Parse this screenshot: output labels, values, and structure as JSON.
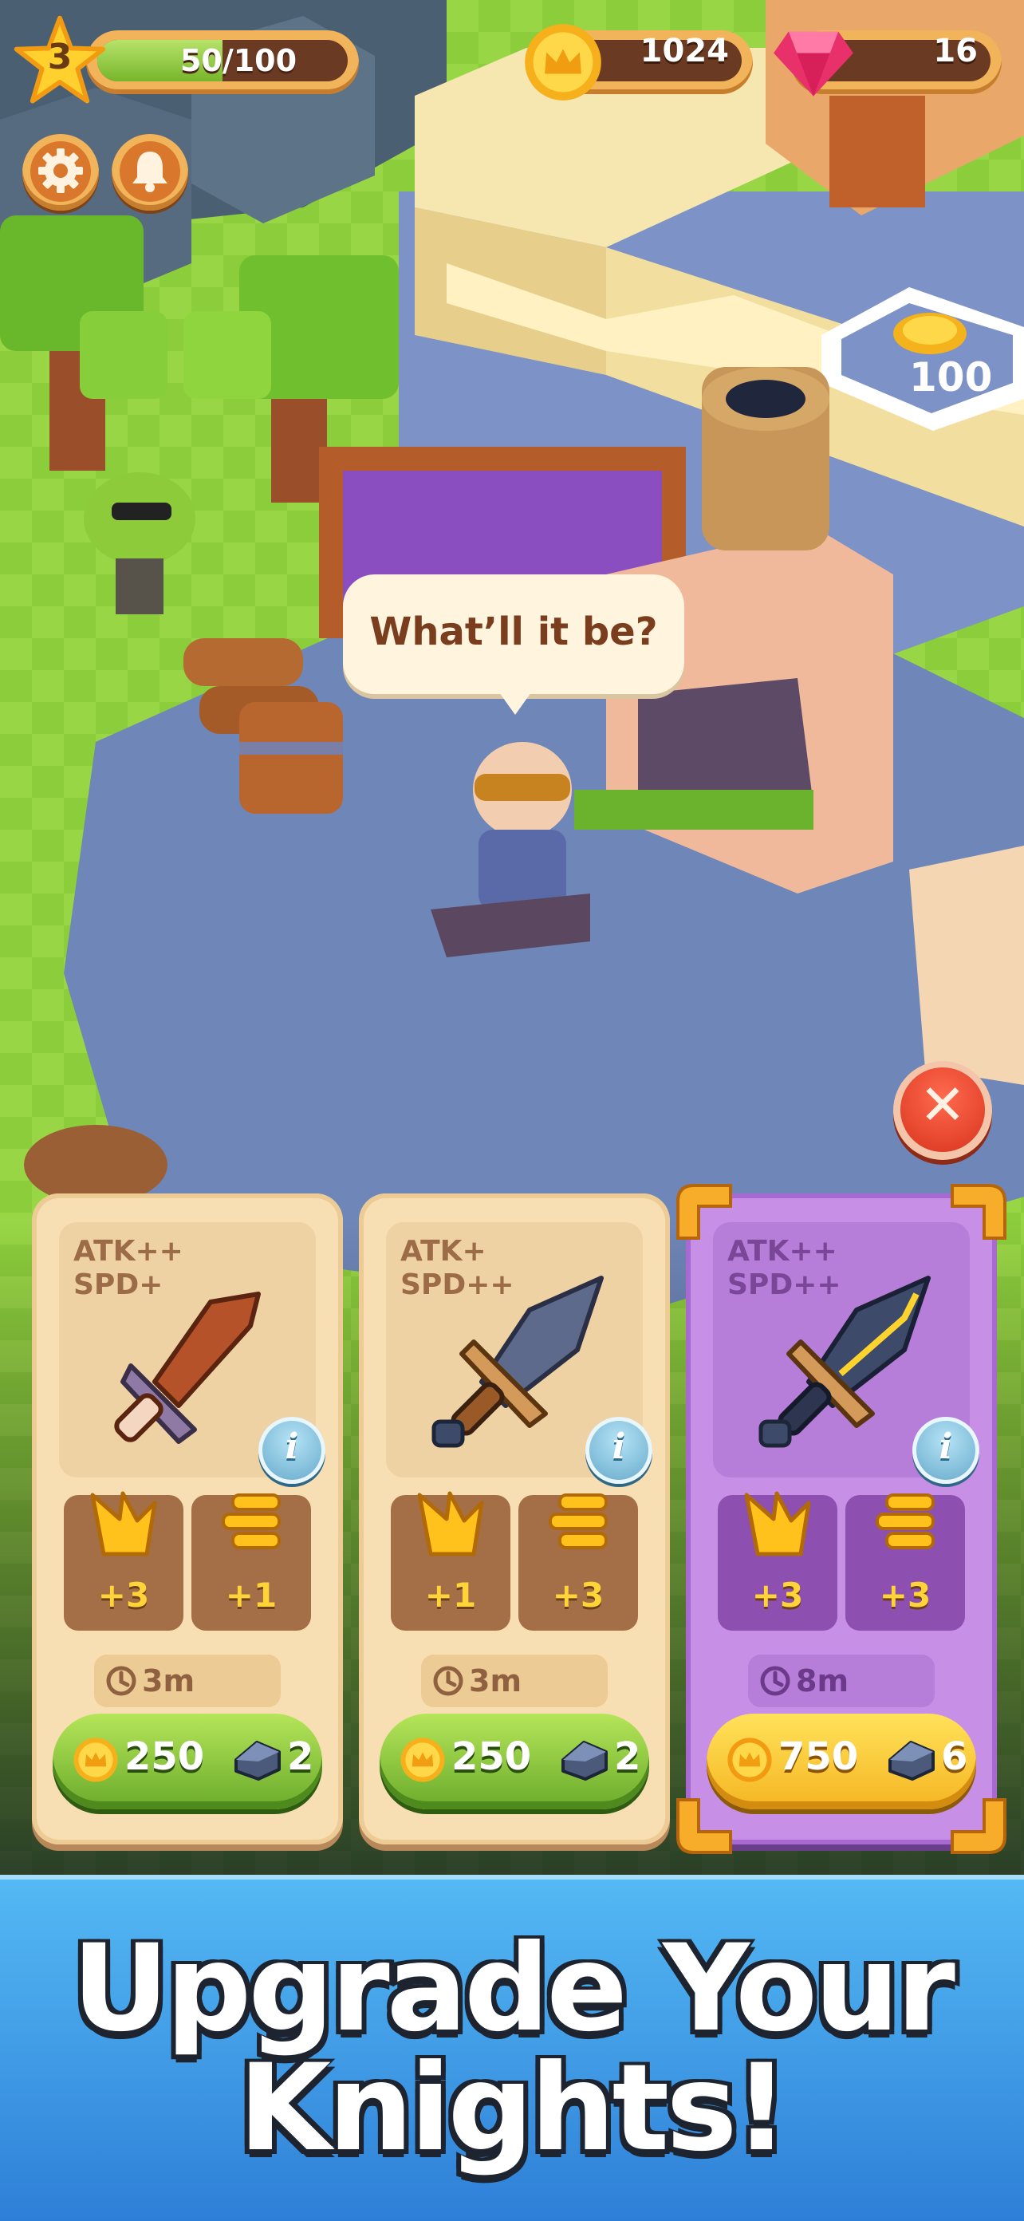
{
  "hud": {
    "level": "3",
    "xp_text": "50/100",
    "xp_progress": 0.5,
    "gold": "1024",
    "gems": "16"
  },
  "map_sign": {
    "value": "100"
  },
  "dialog": {
    "text": "What’ll it be?"
  },
  "cards": [
    {
      "theme": "plain",
      "stat_line1": "ATK++",
      "stat_line2": "SPD+",
      "atk_bonus": "+3",
      "spd_bonus": "+1",
      "time": "3m",
      "gold_cost": "250",
      "ore_cost": "2",
      "info_icon": "info-icon"
    },
    {
      "theme": "plain",
      "stat_line1": "ATK+",
      "stat_line2": "SPD++",
      "atk_bonus": "+1",
      "spd_bonus": "+3",
      "time": "3m",
      "gold_cost": "250",
      "ore_cost": "2",
      "info_icon": "info-icon"
    },
    {
      "theme": "purple",
      "stat_line1": "ATK++",
      "stat_line2": "SPD++",
      "atk_bonus": "+3",
      "spd_bonus": "+3",
      "time": "8m",
      "gold_cost": "750",
      "ore_cost": "6",
      "info_icon": "info-icon"
    }
  ],
  "banner": {
    "line1": "Upgrade Your",
    "line2": "Knights!"
  },
  "colors": {
    "banner_blue": "#3f9ee8",
    "gold": "#ffd438",
    "green_button": "#8ccc3a",
    "purple_card": "#c88fe6"
  }
}
